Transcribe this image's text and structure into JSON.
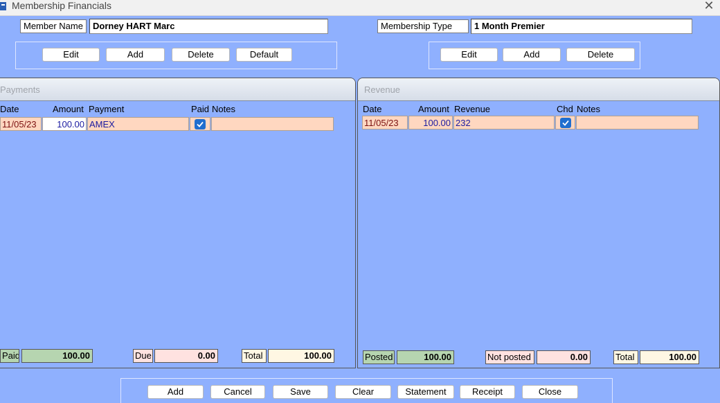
{
  "window": {
    "title": "Membership Financials"
  },
  "member": {
    "name_label": "Member Name",
    "name_value": "Dorney HART Marc"
  },
  "membership": {
    "type_label": "Membership Type",
    "type_value": "1 Month Premier"
  },
  "left_buttons": [
    "Edit",
    "Add",
    "Delete",
    "Default"
  ],
  "right_buttons": [
    "Edit",
    "Add",
    "Delete"
  ],
  "payments": {
    "title": "Payments",
    "columns": [
      "Date",
      "Amount",
      "Payment",
      "Paid",
      "Notes"
    ],
    "rows": [
      {
        "date": "11/05/23",
        "amount": "100.00",
        "payment": "AMEX",
        "paid": true,
        "notes": ""
      }
    ],
    "totals": {
      "paid_label": "Paid",
      "paid_value": "100.00",
      "due_label": "Due",
      "due_value": "0.00",
      "total_label": "Total",
      "total_value": "100.00"
    }
  },
  "revenue": {
    "title": "Revenue",
    "columns": [
      "Date",
      "Amount",
      "Revenue",
      "Chd",
      "Notes"
    ],
    "rows": [
      {
        "date": "11/05/23",
        "amount": "100.00",
        "revenue": "232",
        "chd": true,
        "notes": ""
      }
    ],
    "totals": {
      "posted_label": "Posted",
      "posted_value": "100.00",
      "notposted_label": "Not posted",
      "notposted_value": "0.00",
      "total_label": "Total",
      "total_value": "100.00"
    }
  },
  "bottom_buttons": [
    "Add",
    "Cancel",
    "Save",
    "Clear",
    "Statement",
    "Receipt",
    "Close"
  ],
  "icons": {
    "app": "app-icon",
    "close": "close-icon",
    "check": "checkmark-icon"
  },
  "colors": {
    "background": "#8fb0fe",
    "row_fill": "#ffd7c0",
    "checkbox": "#1f6ecf",
    "paid_fill": "#b6d5b0",
    "due_fill": "#ffe2e0",
    "total_fill": "#fff7e3"
  }
}
